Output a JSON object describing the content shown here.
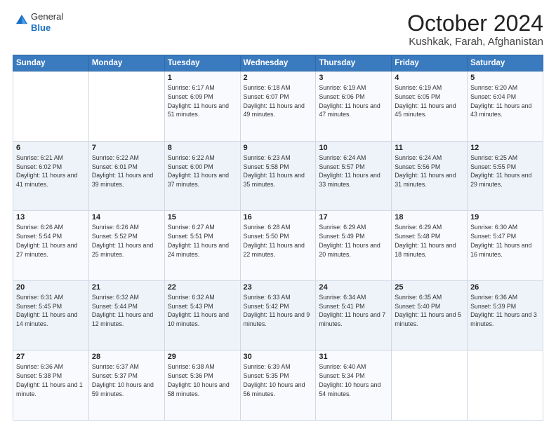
{
  "logo": {
    "general": "General",
    "blue": "Blue"
  },
  "header": {
    "month": "October 2024",
    "location": "Kushkak, Farah, Afghanistan"
  },
  "weekdays": [
    "Sunday",
    "Monday",
    "Tuesday",
    "Wednesday",
    "Thursday",
    "Friday",
    "Saturday"
  ],
  "weeks": [
    [
      {
        "day": "",
        "text": ""
      },
      {
        "day": "",
        "text": ""
      },
      {
        "day": "1",
        "text": "Sunrise: 6:17 AM\nSunset: 6:09 PM\nDaylight: 11 hours and 51 minutes."
      },
      {
        "day": "2",
        "text": "Sunrise: 6:18 AM\nSunset: 6:07 PM\nDaylight: 11 hours and 49 minutes."
      },
      {
        "day": "3",
        "text": "Sunrise: 6:19 AM\nSunset: 6:06 PM\nDaylight: 11 hours and 47 minutes."
      },
      {
        "day": "4",
        "text": "Sunrise: 6:19 AM\nSunset: 6:05 PM\nDaylight: 11 hours and 45 minutes."
      },
      {
        "day": "5",
        "text": "Sunrise: 6:20 AM\nSunset: 6:04 PM\nDaylight: 11 hours and 43 minutes."
      }
    ],
    [
      {
        "day": "6",
        "text": "Sunrise: 6:21 AM\nSunset: 6:02 PM\nDaylight: 11 hours and 41 minutes."
      },
      {
        "day": "7",
        "text": "Sunrise: 6:22 AM\nSunset: 6:01 PM\nDaylight: 11 hours and 39 minutes."
      },
      {
        "day": "8",
        "text": "Sunrise: 6:22 AM\nSunset: 6:00 PM\nDaylight: 11 hours and 37 minutes."
      },
      {
        "day": "9",
        "text": "Sunrise: 6:23 AM\nSunset: 5:58 PM\nDaylight: 11 hours and 35 minutes."
      },
      {
        "day": "10",
        "text": "Sunrise: 6:24 AM\nSunset: 5:57 PM\nDaylight: 11 hours and 33 minutes."
      },
      {
        "day": "11",
        "text": "Sunrise: 6:24 AM\nSunset: 5:56 PM\nDaylight: 11 hours and 31 minutes."
      },
      {
        "day": "12",
        "text": "Sunrise: 6:25 AM\nSunset: 5:55 PM\nDaylight: 11 hours and 29 minutes."
      }
    ],
    [
      {
        "day": "13",
        "text": "Sunrise: 6:26 AM\nSunset: 5:54 PM\nDaylight: 11 hours and 27 minutes."
      },
      {
        "day": "14",
        "text": "Sunrise: 6:26 AM\nSunset: 5:52 PM\nDaylight: 11 hours and 25 minutes."
      },
      {
        "day": "15",
        "text": "Sunrise: 6:27 AM\nSunset: 5:51 PM\nDaylight: 11 hours and 24 minutes."
      },
      {
        "day": "16",
        "text": "Sunrise: 6:28 AM\nSunset: 5:50 PM\nDaylight: 11 hours and 22 minutes."
      },
      {
        "day": "17",
        "text": "Sunrise: 6:29 AM\nSunset: 5:49 PM\nDaylight: 11 hours and 20 minutes."
      },
      {
        "day": "18",
        "text": "Sunrise: 6:29 AM\nSunset: 5:48 PM\nDaylight: 11 hours and 18 minutes."
      },
      {
        "day": "19",
        "text": "Sunrise: 6:30 AM\nSunset: 5:47 PM\nDaylight: 11 hours and 16 minutes."
      }
    ],
    [
      {
        "day": "20",
        "text": "Sunrise: 6:31 AM\nSunset: 5:45 PM\nDaylight: 11 hours and 14 minutes."
      },
      {
        "day": "21",
        "text": "Sunrise: 6:32 AM\nSunset: 5:44 PM\nDaylight: 11 hours and 12 minutes."
      },
      {
        "day": "22",
        "text": "Sunrise: 6:32 AM\nSunset: 5:43 PM\nDaylight: 11 hours and 10 minutes."
      },
      {
        "day": "23",
        "text": "Sunrise: 6:33 AM\nSunset: 5:42 PM\nDaylight: 11 hours and 9 minutes."
      },
      {
        "day": "24",
        "text": "Sunrise: 6:34 AM\nSunset: 5:41 PM\nDaylight: 11 hours and 7 minutes."
      },
      {
        "day": "25",
        "text": "Sunrise: 6:35 AM\nSunset: 5:40 PM\nDaylight: 11 hours and 5 minutes."
      },
      {
        "day": "26",
        "text": "Sunrise: 6:36 AM\nSunset: 5:39 PM\nDaylight: 11 hours and 3 minutes."
      }
    ],
    [
      {
        "day": "27",
        "text": "Sunrise: 6:36 AM\nSunset: 5:38 PM\nDaylight: 11 hours and 1 minute."
      },
      {
        "day": "28",
        "text": "Sunrise: 6:37 AM\nSunset: 5:37 PM\nDaylight: 10 hours and 59 minutes."
      },
      {
        "day": "29",
        "text": "Sunrise: 6:38 AM\nSunset: 5:36 PM\nDaylight: 10 hours and 58 minutes."
      },
      {
        "day": "30",
        "text": "Sunrise: 6:39 AM\nSunset: 5:35 PM\nDaylight: 10 hours and 56 minutes."
      },
      {
        "day": "31",
        "text": "Sunrise: 6:40 AM\nSunset: 5:34 PM\nDaylight: 10 hours and 54 minutes."
      },
      {
        "day": "",
        "text": ""
      },
      {
        "day": "",
        "text": ""
      }
    ]
  ]
}
